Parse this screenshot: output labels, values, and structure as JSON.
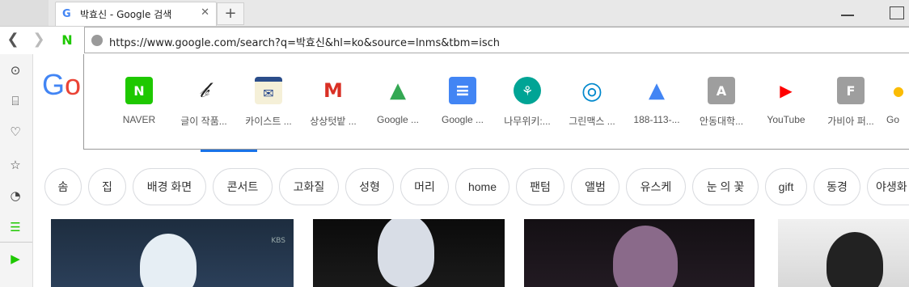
{
  "tab": {
    "favicon": "G",
    "title": "박효신 - Google 검색",
    "close": "✕",
    "new_tab": "+"
  },
  "nav": {
    "back": "❮",
    "forward": "❯",
    "naver_mini": "N"
  },
  "url": "https://www.google.com/search?q=박효신&hl=ko&source=lnms&tbm=isch",
  "side_icons": [
    "search-circle-icon",
    "inbox-icon",
    "pocket-icon",
    "star-icon",
    "history-icon",
    "list-icon",
    "play-icon"
  ],
  "side_glyphs": [
    "⊙",
    "⌸",
    "♡",
    "☆",
    "◔",
    "☰",
    "▶"
  ],
  "google_logo": {
    "g1": "G",
    "o": "o"
  },
  "speed_dial": [
    {
      "label": "NAVER",
      "glyph": "N",
      "bg": "#1ec800",
      "fg": "#ffffff",
      "icon": "naver-icon"
    },
    {
      "label": "글이 작품...",
      "glyph": "𝒷",
      "bg": "#ffffff",
      "fg": "#222222",
      "icon": "pen-signature-icon"
    },
    {
      "label": "카이스트 ...",
      "glyph": "✉",
      "bg": "#f5f0d8",
      "fg": "#1c3f8a",
      "icon": "kaist-mail-icon"
    },
    {
      "label": "상상텃밭 ...",
      "glyph": "M",
      "bg": "#ffffff",
      "fg": "#d93025",
      "icon": "gmail-icon"
    },
    {
      "label": "Google ...",
      "glyph": "▲",
      "bg": "#ffffff",
      "fg": "#34a853",
      "icon": "google-drive-icon"
    },
    {
      "label": "Google ...",
      "glyph": "≡",
      "bg": "#4285f4",
      "fg": "#ffffff",
      "icon": "google-docs-icon"
    },
    {
      "label": "나무위키:...",
      "glyph": "⚘",
      "bg": "#00a495",
      "fg": "#ffffff",
      "icon": "namuwiki-icon"
    },
    {
      "label": "그린맥스 ...",
      "glyph": "◎",
      "bg": "#ffffff",
      "fg": "#0088cc",
      "icon": "greenmax-icon"
    },
    {
      "label": "188-113-...",
      "glyph": "▲",
      "bg": "#ffffff",
      "fg": "#fbbc04",
      "icon": "google-ads-icon"
    },
    {
      "label": "안동대학...",
      "glyph": "A",
      "bg": "#9e9e9e",
      "fg": "#ffffff",
      "icon": "andong-letter-icon"
    },
    {
      "label": "YouTube",
      "glyph": "▶",
      "bg": "#ffffff",
      "fg": "#ff0000",
      "icon": "youtube-icon"
    },
    {
      "label": "가비아 퍼...",
      "glyph": "F",
      "bg": "#9e9e9e",
      "fg": "#ffffff",
      "icon": "gabia-letter-icon"
    },
    {
      "label": "Go",
      "glyph": "●",
      "bg": "#ffffff",
      "fg": "#fbbc04",
      "icon": "google-icon"
    }
  ],
  "chips": [
    "솜",
    "집",
    "배경 화면",
    "콘서트",
    "고화질",
    "성형",
    "머리",
    "home",
    "팬텀",
    "앨범",
    "유스케",
    "눈 의 꽃",
    "gift",
    "동경",
    "야생화"
  ],
  "thumbnail_watermark": "KBS"
}
